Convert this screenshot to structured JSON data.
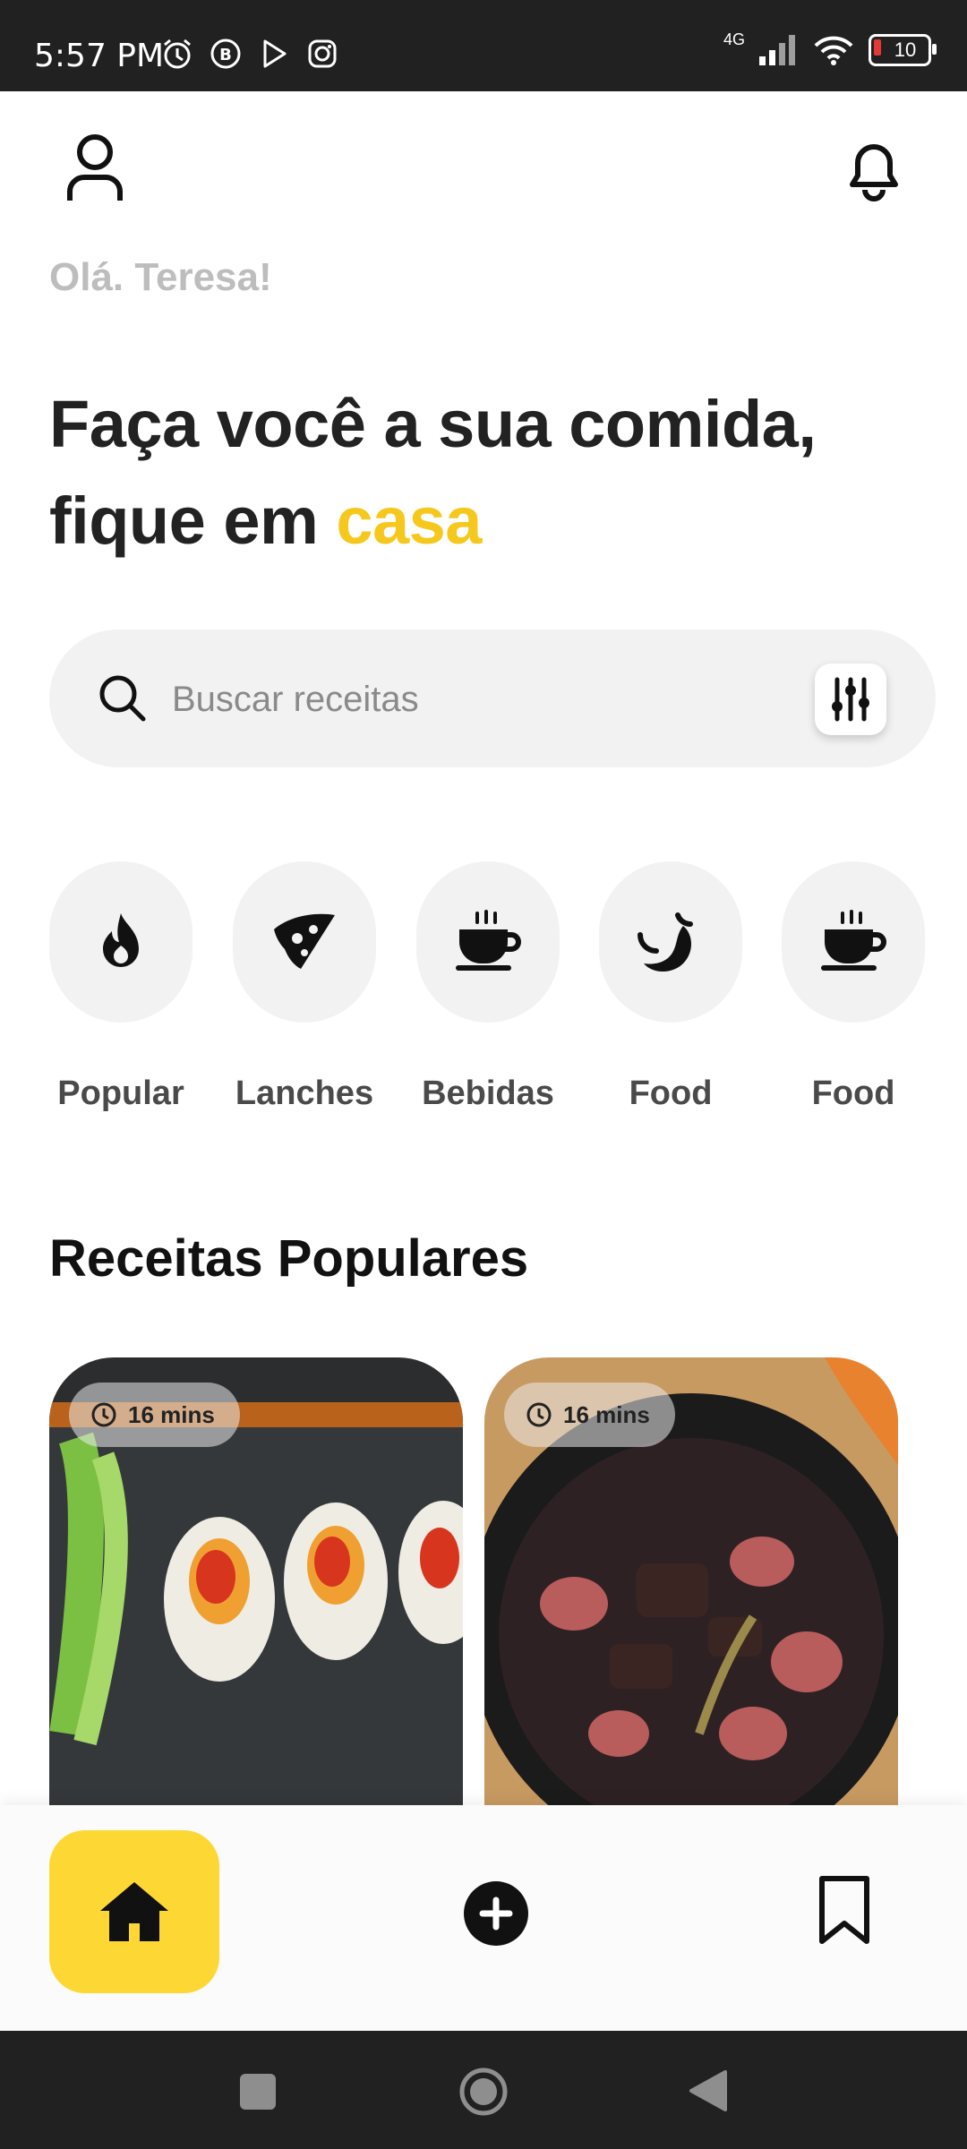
{
  "status_bar": {
    "time": "5:57 PM",
    "network": "4G",
    "battery": "10"
  },
  "header": {
    "greeting": "Olá. Teresa!"
  },
  "headline": {
    "line1": "Faça você a sua comida,",
    "line2_prefix": "fique em ",
    "line2_accent": "casa"
  },
  "search": {
    "placeholder": "Buscar receitas",
    "value": ""
  },
  "categories": [
    {
      "label": "Popular",
      "icon": "flame-icon"
    },
    {
      "label": "Lanches",
      "icon": "pizza-slice-icon"
    },
    {
      "label": "Bebidas",
      "icon": "coffee-cup-icon"
    },
    {
      "label": "Food",
      "icon": "pepper-icon"
    },
    {
      "label": "Food",
      "icon": "coffee-cup-icon"
    }
  ],
  "section": {
    "title": "Receitas Populares"
  },
  "recipes": [
    {
      "time": "16 mins",
      "image": "sushi-rolls-photo"
    },
    {
      "time": "16 mins",
      "image": "bean-stew-photo"
    }
  ],
  "colors": {
    "accent": "#f6c81d",
    "nav_active": "#fdd835",
    "surface": "#f2f2f2"
  }
}
